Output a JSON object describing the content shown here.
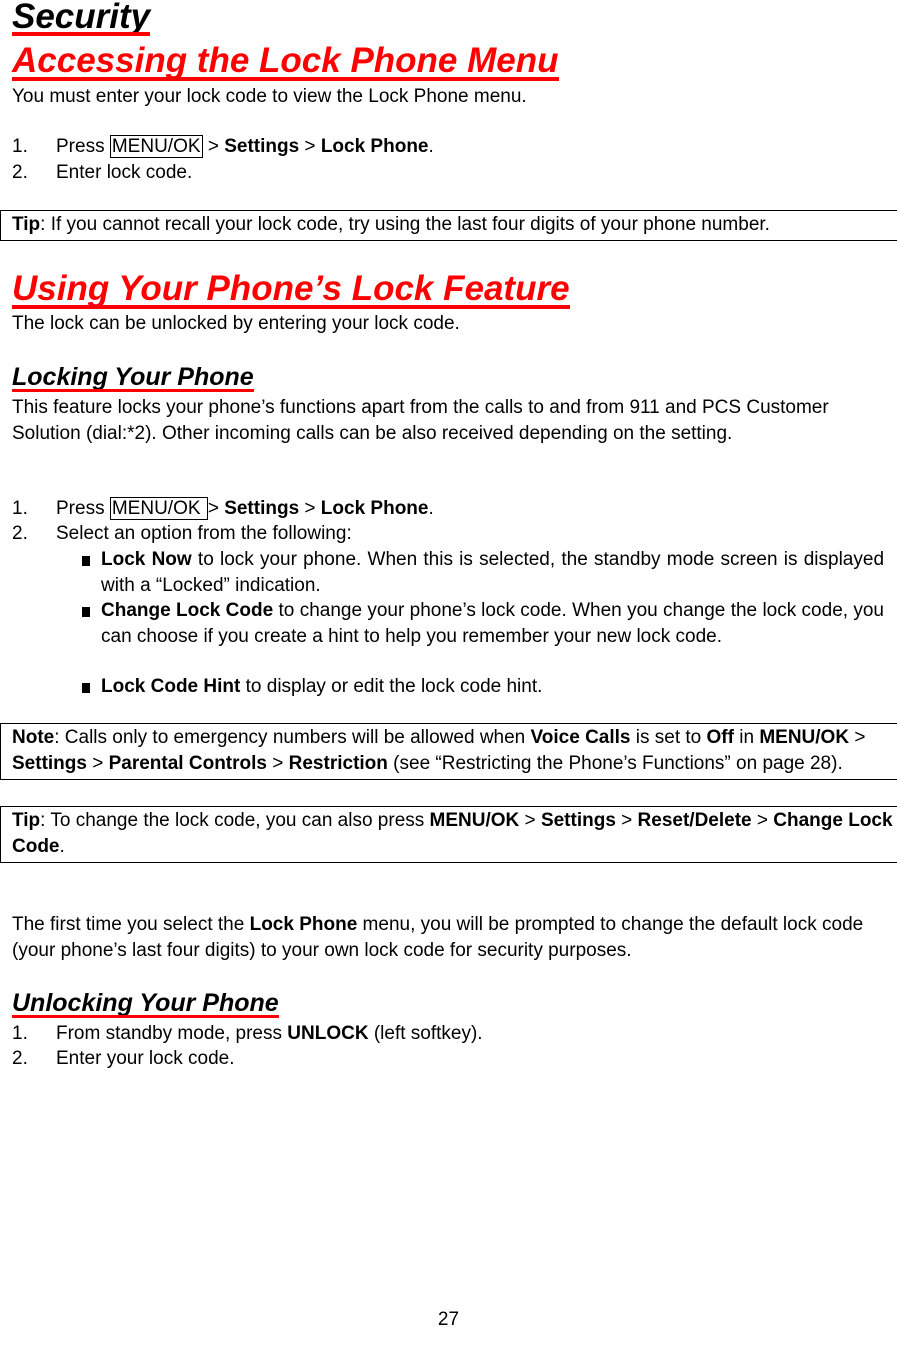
{
  "section_title": "Security",
  "accessing": {
    "heading": "Accessing the Lock Phone Menu",
    "intro": "You must enter your lock code to view the Lock Phone menu.",
    "steps": [
      {
        "num": "1.",
        "pre": "Press ",
        "key": "MENU/OK",
        "sep1": " > ",
        "b1": "Settings",
        "sep2": " > ",
        "b2": "Lock Phone",
        "end": "."
      },
      {
        "num": "2.",
        "text": "Enter lock code."
      }
    ],
    "tip": {
      "label": "Tip",
      "text": ": If you cannot recall your lock code, try using the last four digits of your phone number."
    }
  },
  "using": {
    "heading": "Using Your Phone’s Lock Feature",
    "intro": "The lock can be unlocked by entering your lock code."
  },
  "locking": {
    "heading": "Locking Your Phone",
    "description": "This feature locks your phone’s functions apart from the calls to and from 911 and PCS Customer Solution (dial:*2). Other incoming calls can be also received depending on the setting.",
    "steps": [
      {
        "num": "1.",
        "pre": "Press ",
        "key": "MENU/OK ",
        "sep1": "> ",
        "b1": "Settings",
        "sep2": " > ",
        "b2": "Lock Phone",
        "end": "."
      },
      {
        "num": "2.",
        "text": "Select an option from the following:"
      }
    ],
    "options": [
      {
        "label": "Lock Now",
        "text": " to lock your phone. When this is selected, the standby mode screen is displayed with a “Locked” indication."
      },
      {
        "label": "Change Lock Code",
        "text": " to change your phone’s lock code. When you change the lock code, you can choose if you create a hint to help you remember your new lock code."
      },
      {
        "label": "Lock Code Hint",
        "text": " to display or edit the lock code hint."
      }
    ],
    "note": {
      "label": "Note",
      "t1": ": Calls only to emergency numbers will be allowed when ",
      "b1": "Voice Calls",
      "t2": " is set to ",
      "b2": "Off",
      "t3": " in ",
      "b3": "MENU/OK",
      "t4": " > ",
      "b4": "Settings",
      "t5": " > ",
      "b5": "Parental Controls",
      "t6": " > ",
      "b6": "Restriction",
      "t7": " (see “Restricting the Phone’s Functions” on page 28)."
    },
    "tip2": {
      "label": "Tip",
      "t1": ": To change the lock code, you can also press ",
      "b1": "MENU/OK",
      "t2": " > ",
      "b2": "Settings",
      "t3": " > ",
      "b3": "Reset/Delete",
      "t4": " > ",
      "b4": "Change Lock Code",
      "t5": "."
    },
    "first_time": {
      "t1": "The first time you select the ",
      "b1": "Lock Phone",
      "t2": " menu, you will be prompted to change the default lock code (your phone’s last four digits) to your own lock code for security purposes."
    }
  },
  "unlocking": {
    "heading": "Unlocking Your Phone",
    "steps": [
      {
        "num": "1.",
        "pre": "From standby mode, press ",
        "b1": "UNLOCK",
        "end": " (left softkey)."
      },
      {
        "num": "2.",
        "text": "Enter your lock code."
      }
    ]
  },
  "page_number": "27"
}
